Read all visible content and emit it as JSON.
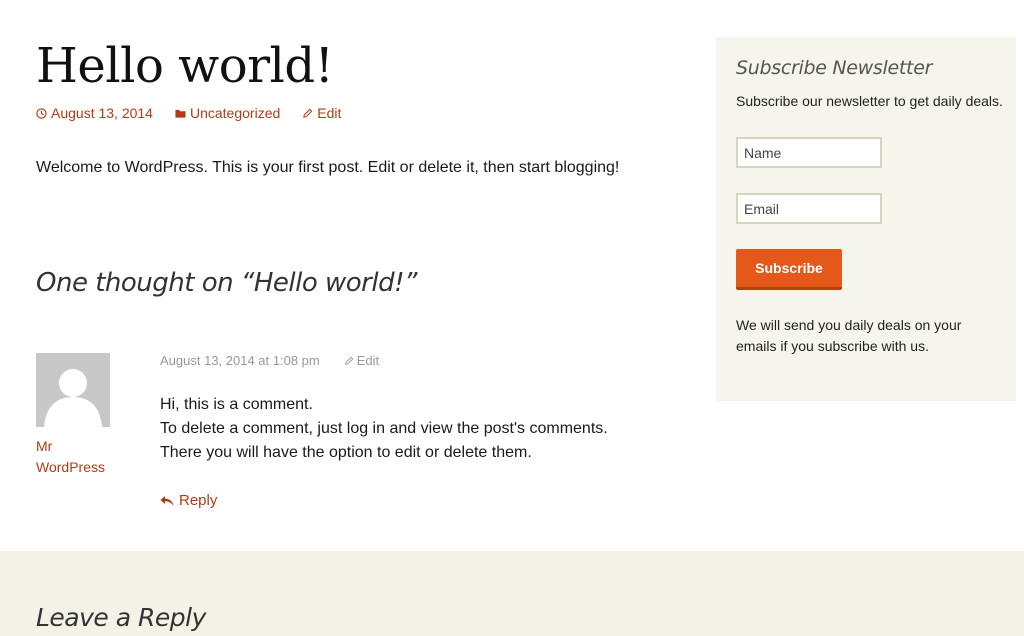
{
  "post": {
    "title": "Hello world!",
    "meta": {
      "date": "August 13, 2014",
      "category": "Uncategorized",
      "edit": "Edit"
    },
    "content": "Welcome to WordPress. This is your first post. Edit or delete it, then start blogging!"
  },
  "comments": {
    "title": "One thought on “Hello world!”",
    "items": [
      {
        "author_line1": "Mr",
        "author_line2": "WordPress",
        "date": "August 13, 2014 at 1:08 pm",
        "edit": "Edit",
        "line1": "Hi, this is a comment.",
        "line2": "To delete a comment, just log in and view the post's comments. There you will have the option to edit or delete them.",
        "reply": "Reply"
      }
    ]
  },
  "sidebar": {
    "widget_title": "Subscribe Newsletter",
    "description": "Subscribe our newsletter to get daily deals.",
    "name_placeholder": "Name",
    "email_placeholder": "Email",
    "button_label": "Subscribe",
    "note": "We will send you daily deals on your emails if you subscribe with us."
  },
  "reply_section": {
    "title": "Leave a Reply"
  },
  "colors": {
    "link": "#b23b14",
    "button": "#e4581a",
    "widget_bg": "#f6f5ec",
    "footer_bg": "#f4f2e6"
  },
  "icons": [
    "clock-icon",
    "folder-icon",
    "pencil-icon",
    "reply-arrow-icon",
    "avatar-icon"
  ]
}
